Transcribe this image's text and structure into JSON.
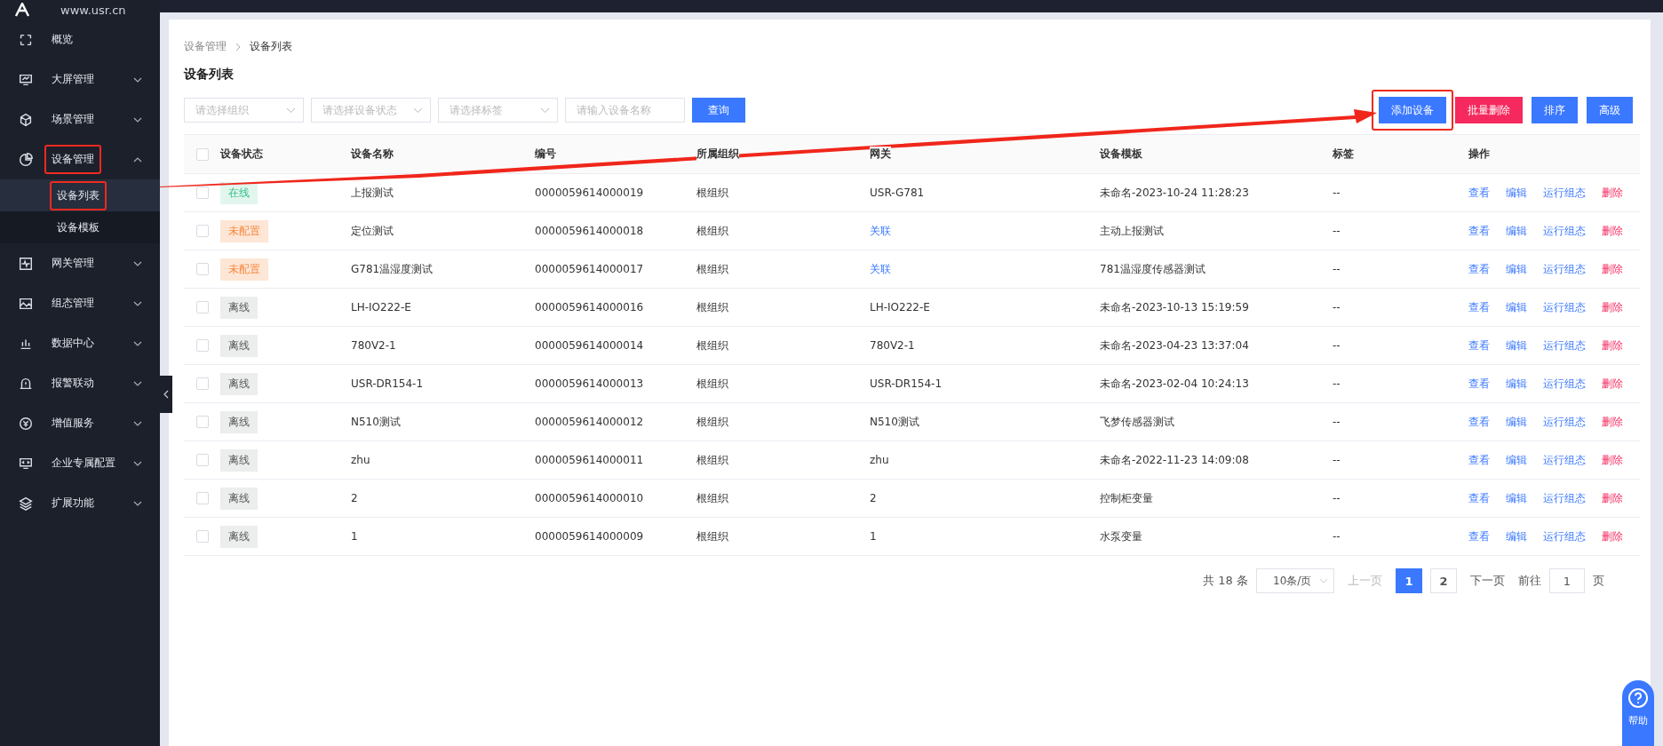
{
  "brand": {
    "site": "www.usr.cn"
  },
  "sidebar": {
    "items": [
      {
        "label": "概览",
        "expandable": false,
        "highlighted": false
      },
      {
        "label": "大屏管理",
        "expandable": true,
        "expanded": false,
        "highlighted": false
      },
      {
        "label": "场景管理",
        "expandable": true,
        "expanded": false,
        "highlighted": false
      },
      {
        "label": "设备管理",
        "expandable": true,
        "expanded": true,
        "highlighted": true,
        "children": [
          {
            "label": "设备列表",
            "selected": true,
            "highlighted": true
          },
          {
            "label": "设备模板",
            "selected": false,
            "highlighted": false
          }
        ]
      },
      {
        "label": "网关管理",
        "expandable": true,
        "expanded": false,
        "highlighted": false
      },
      {
        "label": "组态管理",
        "expandable": true,
        "expanded": false,
        "highlighted": false
      },
      {
        "label": "数据中心",
        "expandable": true,
        "expanded": false,
        "highlighted": false
      },
      {
        "label": "报警联动",
        "expandable": true,
        "expanded": false,
        "highlighted": false
      },
      {
        "label": "增值服务",
        "expandable": true,
        "expanded": false,
        "highlighted": false
      },
      {
        "label": "企业专属配置",
        "expandable": true,
        "expanded": false,
        "highlighted": false
      },
      {
        "label": "扩展功能",
        "expandable": true,
        "expanded": false,
        "highlighted": false
      }
    ]
  },
  "breadcrumb": [
    "设备管理",
    "设备列表"
  ],
  "page_title": "设备列表",
  "filters": [
    {
      "placeholder": "请选择组织",
      "kind": "select"
    },
    {
      "placeholder": "请选择设备状态",
      "kind": "select"
    },
    {
      "placeholder": "请选择标签",
      "kind": "select"
    },
    {
      "placeholder": "请输入设备名称",
      "kind": "input"
    }
  ],
  "query_button": "查询",
  "actions": [
    {
      "label": "添加设备",
      "kind": "primary",
      "highlighted": true
    },
    {
      "label": "批量删除",
      "kind": "danger",
      "highlighted": false
    },
    {
      "label": "排序",
      "kind": "primary",
      "highlighted": false
    },
    {
      "label": "高级",
      "kind": "primary",
      "highlighted": false
    }
  ],
  "table": {
    "header_checked": false,
    "columns": [
      "设备状态",
      "设备名称",
      "编号",
      "所属组织",
      "网关",
      "设备模板",
      "标签",
      "操作"
    ],
    "rows": [
      {
        "checked": false,
        "status": {
          "text": "在线",
          "kind": "online"
        },
        "name": "上报测试",
        "code": "0000059614000019",
        "org": "根组织",
        "gateway": {
          "text": "USR-G781",
          "link": false
        },
        "template": "未命名-2023-10-24 11:28:23",
        "tag": "--",
        "actions": [
          {
            "label": "查看",
            "kind": "normal"
          },
          {
            "label": "编辑",
            "kind": "normal"
          },
          {
            "label": "运行组态",
            "kind": "normal"
          },
          {
            "label": "删除",
            "kind": "danger"
          }
        ]
      },
      {
        "checked": false,
        "status": {
          "text": "未配置",
          "kind": "unconfigured"
        },
        "name": "定位测试",
        "code": "0000059614000018",
        "org": "根组织",
        "gateway": {
          "text": "关联",
          "link": true
        },
        "template": "主动上报测试",
        "tag": "--",
        "actions": [
          {
            "label": "查看",
            "kind": "normal"
          },
          {
            "label": "编辑",
            "kind": "normal"
          },
          {
            "label": "运行组态",
            "kind": "normal"
          },
          {
            "label": "删除",
            "kind": "danger"
          }
        ]
      },
      {
        "checked": false,
        "status": {
          "text": "未配置",
          "kind": "unconfigured"
        },
        "name": "G781温湿度测试",
        "code": "0000059614000017",
        "org": "根组织",
        "gateway": {
          "text": "关联",
          "link": true
        },
        "template": "781温湿度传感器测试",
        "tag": "--",
        "actions": [
          {
            "label": "查看",
            "kind": "normal"
          },
          {
            "label": "编辑",
            "kind": "normal"
          },
          {
            "label": "运行组态",
            "kind": "normal"
          },
          {
            "label": "删除",
            "kind": "danger"
          }
        ]
      },
      {
        "checked": false,
        "status": {
          "text": "离线",
          "kind": "offline"
        },
        "name": "LH-IO222-E",
        "code": "0000059614000016",
        "org": "根组织",
        "gateway": {
          "text": "LH-IO222-E",
          "link": false
        },
        "template": "未命名-2023-10-13 15:19:59",
        "tag": "--",
        "actions": [
          {
            "label": "查看",
            "kind": "normal"
          },
          {
            "label": "编辑",
            "kind": "normal"
          },
          {
            "label": "运行组态",
            "kind": "normal"
          },
          {
            "label": "删除",
            "kind": "danger"
          }
        ]
      },
      {
        "checked": false,
        "status": {
          "text": "离线",
          "kind": "offline"
        },
        "name": "780V2-1",
        "code": "0000059614000014",
        "org": "根组织",
        "gateway": {
          "text": "780V2-1",
          "link": false
        },
        "template": "未命名-2023-04-23 13:37:04",
        "tag": "--",
        "actions": [
          {
            "label": "查看",
            "kind": "normal"
          },
          {
            "label": "编辑",
            "kind": "normal"
          },
          {
            "label": "运行组态",
            "kind": "normal"
          },
          {
            "label": "删除",
            "kind": "danger"
          }
        ]
      },
      {
        "checked": false,
        "status": {
          "text": "离线",
          "kind": "offline"
        },
        "name": "USR-DR154-1",
        "code": "0000059614000013",
        "org": "根组织",
        "gateway": {
          "text": "USR-DR154-1",
          "link": false
        },
        "template": "未命名-2023-02-04 10:24:13",
        "tag": "--",
        "actions": [
          {
            "label": "查看",
            "kind": "normal"
          },
          {
            "label": "编辑",
            "kind": "normal"
          },
          {
            "label": "运行组态",
            "kind": "normal"
          },
          {
            "label": "删除",
            "kind": "danger"
          }
        ]
      },
      {
        "checked": false,
        "status": {
          "text": "离线",
          "kind": "offline"
        },
        "name": "N510测试",
        "code": "0000059614000012",
        "org": "根组织",
        "gateway": {
          "text": "N510测试",
          "link": false
        },
        "template": "飞梦传感器测试",
        "tag": "--",
        "actions": [
          {
            "label": "查看",
            "kind": "normal"
          },
          {
            "label": "编辑",
            "kind": "normal"
          },
          {
            "label": "运行组态",
            "kind": "normal"
          },
          {
            "label": "删除",
            "kind": "danger"
          }
        ]
      },
      {
        "checked": false,
        "status": {
          "text": "离线",
          "kind": "offline"
        },
        "name": "zhu",
        "code": "0000059614000011",
        "org": "根组织",
        "gateway": {
          "text": "zhu",
          "link": false
        },
        "template": "未命名-2022-11-23 14:09:08",
        "tag": "--",
        "actions": [
          {
            "label": "查看",
            "kind": "normal"
          },
          {
            "label": "编辑",
            "kind": "normal"
          },
          {
            "label": "运行组态",
            "kind": "normal"
          },
          {
            "label": "删除",
            "kind": "danger"
          }
        ]
      },
      {
        "checked": false,
        "status": {
          "text": "离线",
          "kind": "offline"
        },
        "name": "2",
        "code": "0000059614000010",
        "org": "根组织",
        "gateway": {
          "text": "2",
          "link": false
        },
        "template": "控制柜变量",
        "tag": "--",
        "actions": [
          {
            "label": "查看",
            "kind": "normal"
          },
          {
            "label": "编辑",
            "kind": "normal"
          },
          {
            "label": "运行组态",
            "kind": "normal"
          },
          {
            "label": "删除",
            "kind": "danger"
          }
        ]
      },
      {
        "checked": false,
        "status": {
          "text": "离线",
          "kind": "offline"
        },
        "name": "1",
        "code": "0000059614000009",
        "org": "根组织",
        "gateway": {
          "text": "1",
          "link": false
        },
        "template": "水泵变量",
        "tag": "--",
        "actions": [
          {
            "label": "查看",
            "kind": "normal"
          },
          {
            "label": "编辑",
            "kind": "normal"
          },
          {
            "label": "运行组态",
            "kind": "normal"
          },
          {
            "label": "删除",
            "kind": "danger"
          }
        ]
      }
    ]
  },
  "pagination": {
    "total": "共 18 条",
    "page_size": "10条/页",
    "prev": {
      "label": "上一页",
      "disabled": true
    },
    "pages": [
      {
        "label": "1",
        "selected": true
      },
      {
        "label": "2",
        "selected": false
      }
    ],
    "next": {
      "label": "下一页",
      "disabled": false
    },
    "goto_label": "前往",
    "goto_value": "1",
    "goto_suffix": "页"
  },
  "help": {
    "label": "帮助"
  }
}
